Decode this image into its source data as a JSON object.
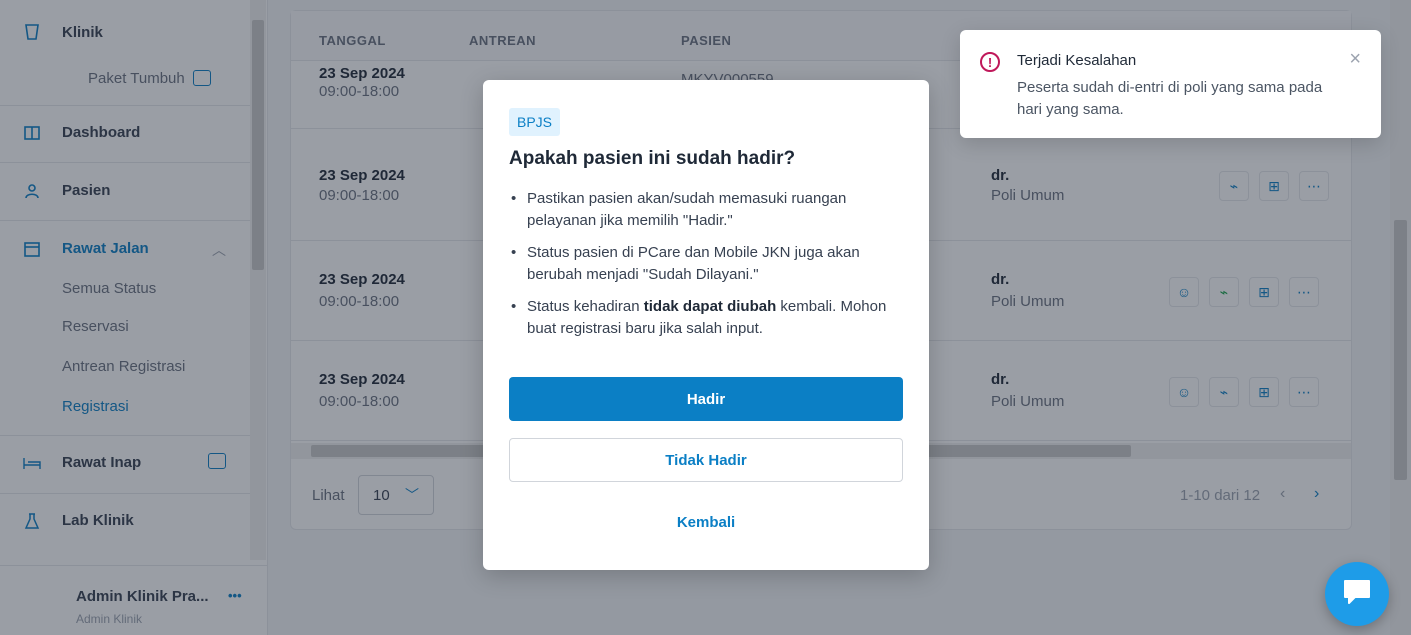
{
  "sidebar": {
    "clinic_label": "Klinik",
    "package_label": "Paket Tumbuh",
    "items": [
      {
        "label": "Dashboard"
      },
      {
        "label": "Pasien"
      },
      {
        "label": "Rawat Jalan"
      },
      {
        "label": "Rawat Inap"
      },
      {
        "label": "Lab Klinik"
      }
    ],
    "rawat_jalan_sub": [
      "Semua Status",
      "Reservasi",
      "Antrean Registrasi",
      "Registrasi"
    ],
    "user_name": "Admin Klinik Pra...",
    "user_role": "Admin Klinik",
    "more": "•••"
  },
  "table": {
    "headers": [
      "TANGGAL",
      "ANTREAN",
      "PASIEN"
    ],
    "rows": [
      {
        "date": "23 Sep 2024",
        "time": "09:00-18:00",
        "patient": "MKYV000559",
        "doctor": "",
        "poli": ""
      },
      {
        "date": "23 Sep 2024",
        "time": "09:00-18:00",
        "patient": "",
        "doctor": "dr.",
        "poli": "Poli Umum"
      },
      {
        "date": "23 Sep 2024",
        "time": "09:00-18:00",
        "patient": "",
        "doctor": "dr.",
        "poli": "Poli Umum"
      },
      {
        "date": "23 Sep 2024",
        "time": "09:00-18:00",
        "patient": "",
        "doctor": "dr.",
        "poli": "Poli Umum"
      }
    ],
    "pager_label": "Lihat",
    "pager_size": "10",
    "pager_range": "1-10 dari 12"
  },
  "modal": {
    "badge": "BPJS",
    "title": "Apakah pasien ini sudah hadir?",
    "item1": "Pastikan pasien akan/sudah memasuki ruangan pelayanan jika memilih \"Hadir.\"",
    "item2": "Status pasien di PCare dan Mobile JKN juga akan berubah menjadi \"Sudah Dilayani.\"",
    "item3_pre": "Status kehadiran ",
    "item3_bold": "tidak dapat diubah",
    "item3_post": " kembali. Mohon buat registrasi baru jika salah input.",
    "btn_hadir": "Hadir",
    "btn_tidak_hadir": "Tidak Hadir",
    "btn_kembali": "Kembali"
  },
  "toast": {
    "title": "Terjadi Kesalahan",
    "message": "Peserta sudah di-entri di poli yang sama pada hari yang sama.",
    "close": "×"
  },
  "colors": {
    "primary": "#0b7fc5",
    "error": "#c0185a",
    "fab": "#1e9ce8"
  }
}
